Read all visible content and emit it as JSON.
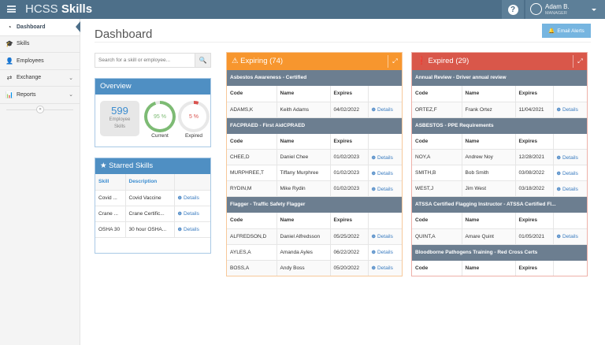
{
  "header": {
    "brand_light": "HCSS",
    "brand_bold": "Skills",
    "help_icon": "question-circle-icon",
    "user_name": "Adam B.",
    "user_role": "MANAGER"
  },
  "sidebar": {
    "items": [
      {
        "label": "Dashboard",
        "icon": "dashboard-icon",
        "glyph": "◔",
        "active": true
      },
      {
        "label": "Skills",
        "icon": "graduation-cap-icon",
        "glyph": "🎓"
      },
      {
        "label": "Employees",
        "icon": "user-icon",
        "glyph": "👤"
      },
      {
        "label": "Exchange",
        "icon": "exchange-icon",
        "glyph": "⇄",
        "chevron": true
      },
      {
        "label": "Reports",
        "icon": "bar-chart-icon",
        "glyph": "📊",
        "chevron": true
      }
    ],
    "collapse_glyph": "«"
  },
  "main": {
    "title": "Dashboard",
    "email_alerts": "Email Alerts",
    "search_placeholder": "Search for a skill or employee...",
    "overview": {
      "title": "Overview",
      "employee_count": "599",
      "employee_label_1": "Employee",
      "employee_label_2": "Skills",
      "current_pct": "95 %",
      "current_value": 95,
      "current_label": "Current",
      "expired_pct": "5 %",
      "expired_value": 5,
      "expired_label": "Expired",
      "current_color": "#7dbb74",
      "expired_color": "#d9534f"
    },
    "starred": {
      "title": "Starred Skills",
      "columns": [
        "Skill",
        "Description",
        ""
      ],
      "rows": [
        {
          "skill": "Covid ...",
          "description": "Covid Vaccine",
          "action": "Details"
        },
        {
          "skill": "Crane ...",
          "description": "Crane Certific...",
          "action": "Details"
        },
        {
          "skill": "OSHA 30",
          "description": "30 hour OSHA...",
          "action": "Details"
        }
      ]
    }
  },
  "expiring": {
    "title": "Expiring (74)",
    "color": "#f7962e",
    "columns": [
      "Code",
      "Name",
      "Expires",
      ""
    ],
    "groups": [
      {
        "title": "Asbestos Awareness - Certified",
        "rows": [
          [
            "ADAMS,K",
            "Keith Adams",
            "04/02/2022",
            "Details"
          ]
        ]
      },
      {
        "title": "FACPRAED - First AidCPRAED",
        "rows": [
          [
            "CHEE,D",
            "Daniel Chee",
            "01/02/2023",
            "Details"
          ],
          [
            "MURPHREE,T",
            "Tiffany Murphree",
            "01/02/2023",
            "Details"
          ],
          [
            "RYDIN,M",
            "Mike Rydin",
            "01/02/2023",
            "Details"
          ]
        ]
      },
      {
        "title": "Flagger - Traffic Safety Flagger",
        "rows": [
          [
            "ALFREDSON,D",
            "Daniel Alfredsson",
            "05/25/2022",
            "Details"
          ],
          [
            "AYLES,A",
            "Amanda Ayles",
            "06/22/2022",
            "Details"
          ],
          [
            "BOSS,A",
            "Andy Boss",
            "05/20/2022",
            "Details"
          ]
        ]
      }
    ]
  },
  "expired": {
    "title": "Expired (29)",
    "color": "#d9574a",
    "columns": [
      "Code",
      "Name",
      "Expires",
      ""
    ],
    "groups": [
      {
        "title": "Annual Review - Driver annual review",
        "rows": [
          [
            "ORTEZ,F",
            "Frank Ortez",
            "11/04/2021",
            "Details"
          ]
        ]
      },
      {
        "title": "ASBESTOS - PPE Requirements",
        "rows": [
          [
            "NOY,A",
            "Andrew Noy",
            "12/28/2021",
            "Details"
          ],
          [
            "SMITH,B",
            "Bob Smith",
            "03/08/2022",
            "Details"
          ],
          [
            "WEST,J",
            "Jim West",
            "03/18/2022",
            "Details"
          ]
        ]
      },
      {
        "title": "ATSSA Certified Flagging Instructor - ATSSA Certified Fl...",
        "rows": [
          [
            "QUINT,A",
            "Amare Quint",
            "01/05/2021",
            "Details"
          ]
        ]
      },
      {
        "title": "Bloodborne Pathogens Training - Red Cross Certs",
        "rows": []
      }
    ]
  }
}
